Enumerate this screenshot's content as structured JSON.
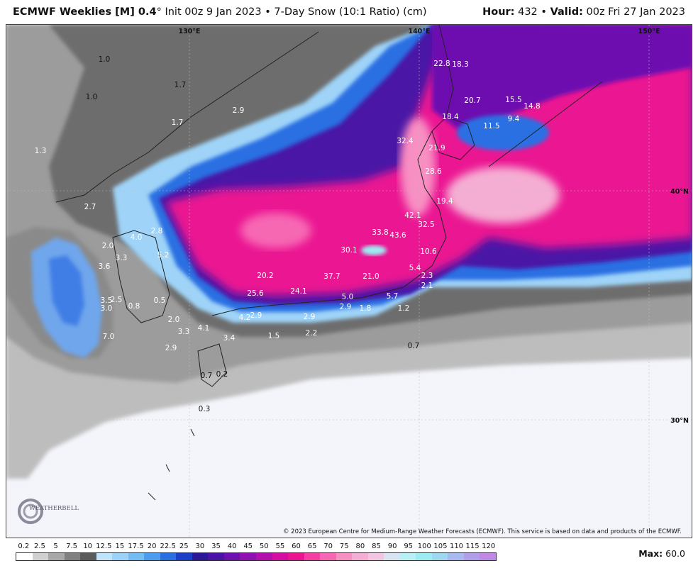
{
  "header": {
    "model": "ECMWF Weeklies [M] 0.4",
    "degree": "°",
    "init": "Init 00z 9 Jan 2023",
    "bullet": "•",
    "product": "7-Day Snow (10:1 Ratio) (cm)",
    "hour_label": "Hour:",
    "hour": "432",
    "valid_label": "Valid:",
    "valid": "00z Fri 27 Jan 2023"
  },
  "map": {
    "lon_labels": [
      "130°E",
      "140°E",
      "150°E"
    ],
    "lat_labels": [
      "40°N",
      "30°N"
    ],
    "credit": "© 2023 European Centre for Medium-Range Weather Forecasts (ECMWF). This service is based on data and products of the ECMWF.",
    "logo_text": "WEATHERBELL",
    "values": [
      "1.0",
      "1.0",
      "1.7",
      "1.7",
      "2.9",
      "1.3",
      "2.7",
      "2.8",
      "4.0",
      "5.2",
      "2.0",
      "3.3",
      "3.6",
      "3.5",
      "3.0",
      "2.5",
      "0.8",
      "0.5",
      "2.0",
      "3.3",
      "4.1",
      "7.0",
      "2.9",
      "4.2",
      "2.9",
      "3.4",
      "1.5",
      "2.9",
      "2.2",
      "0.7",
      "0.2",
      "0.3",
      "20.2",
      "25.6",
      "24.1",
      "37.7",
      "21.0",
      "5.0",
      "2.9",
      "1.8",
      "5.7",
      "1.2",
      "30.1",
      "33.8",
      "43.6",
      "42.1",
      "32.5",
      "10.6",
      "5.4",
      "2.3",
      "2.1",
      "19.4",
      "28.6",
      "21.9",
      "32.4",
      "18.4",
      "22.8",
      "18.3",
      "20.7",
      "15.5",
      "14.8",
      "9.4",
      "11.5",
      "0.7"
    ]
  },
  "legend": {
    "ticks": [
      "0.2",
      "2.5",
      "5",
      "7.5",
      "10",
      "12.5",
      "15",
      "17.5",
      "20",
      "22.5",
      "25",
      "30",
      "35",
      "40",
      "45",
      "50",
      "55",
      "60",
      "65",
      "70",
      "75",
      "80",
      "85",
      "90",
      "95",
      "100",
      "105",
      "110",
      "115",
      "120"
    ],
    "colors": [
      "#ffffff",
      "#d0d0d0",
      "#a8a8a8",
      "#808080",
      "#5a5a5a",
      "#bfe4fb",
      "#9cd2f8",
      "#74bdf4",
      "#4a9df0",
      "#2a6fe2",
      "#1d3fc8",
      "#2a1898",
      "#4a12a6",
      "#6d10b0",
      "#9010b4",
      "#b30fad",
      "#d40ea0",
      "#eb1592",
      "#f53ea2",
      "#f767b3",
      "#f88fc3",
      "#f5aed3",
      "#f0c6e0",
      "#d8e4f2",
      "#b8f0f5",
      "#9eecf2",
      "#9fd6f0",
      "#a7b9ee",
      "#b19ee9",
      "#bf89e6"
    ],
    "max_label": "Max:",
    "max_value": "60.0"
  }
}
